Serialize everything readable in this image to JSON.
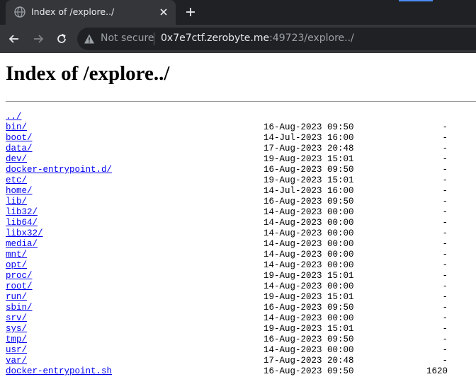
{
  "browser": {
    "tab_title": "Index of /explore../",
    "security_label": "Not secure",
    "url_host": "0x7e7ctf.zerobyte.me",
    "url_rest": ":49723/explore../"
  },
  "page": {
    "title": "Index of /explore../"
  },
  "listing": [
    {
      "name": "../",
      "date": "",
      "size": ""
    },
    {
      "name": "bin/",
      "date": "16-Aug-2023 09:50",
      "size": "-"
    },
    {
      "name": "boot/",
      "date": "14-Jul-2023 16:00",
      "size": "-"
    },
    {
      "name": "data/",
      "date": "17-Aug-2023 20:48",
      "size": "-"
    },
    {
      "name": "dev/",
      "date": "19-Aug-2023 15:01",
      "size": "-"
    },
    {
      "name": "docker-entrypoint.d/",
      "date": "16-Aug-2023 09:50",
      "size": "-"
    },
    {
      "name": "etc/",
      "date": "19-Aug-2023 15:01",
      "size": "-"
    },
    {
      "name": "home/",
      "date": "14-Jul-2023 16:00",
      "size": "-"
    },
    {
      "name": "lib/",
      "date": "16-Aug-2023 09:50",
      "size": "-"
    },
    {
      "name": "lib32/",
      "date": "14-Aug-2023 00:00",
      "size": "-"
    },
    {
      "name": "lib64/",
      "date": "14-Aug-2023 00:00",
      "size": "-"
    },
    {
      "name": "libx32/",
      "date": "14-Aug-2023 00:00",
      "size": "-"
    },
    {
      "name": "media/",
      "date": "14-Aug-2023 00:00",
      "size": "-"
    },
    {
      "name": "mnt/",
      "date": "14-Aug-2023 00:00",
      "size": "-"
    },
    {
      "name": "opt/",
      "date": "14-Aug-2023 00:00",
      "size": "-"
    },
    {
      "name": "proc/",
      "date": "19-Aug-2023 15:01",
      "size": "-"
    },
    {
      "name": "root/",
      "date": "14-Aug-2023 00:00",
      "size": "-"
    },
    {
      "name": "run/",
      "date": "19-Aug-2023 15:01",
      "size": "-"
    },
    {
      "name": "sbin/",
      "date": "16-Aug-2023 09:50",
      "size": "-"
    },
    {
      "name": "srv/",
      "date": "14-Aug-2023 00:00",
      "size": "-"
    },
    {
      "name": "sys/",
      "date": "19-Aug-2023 15:01",
      "size": "-"
    },
    {
      "name": "tmp/",
      "date": "16-Aug-2023 09:50",
      "size": "-"
    },
    {
      "name": "usr/",
      "date": "14-Aug-2023 00:00",
      "size": "-"
    },
    {
      "name": "var/",
      "date": "17-Aug-2023 20:48",
      "size": "-"
    },
    {
      "name": "docker-entrypoint.sh",
      "date": "16-Aug-2023 09:50",
      "size": "1620"
    }
  ]
}
